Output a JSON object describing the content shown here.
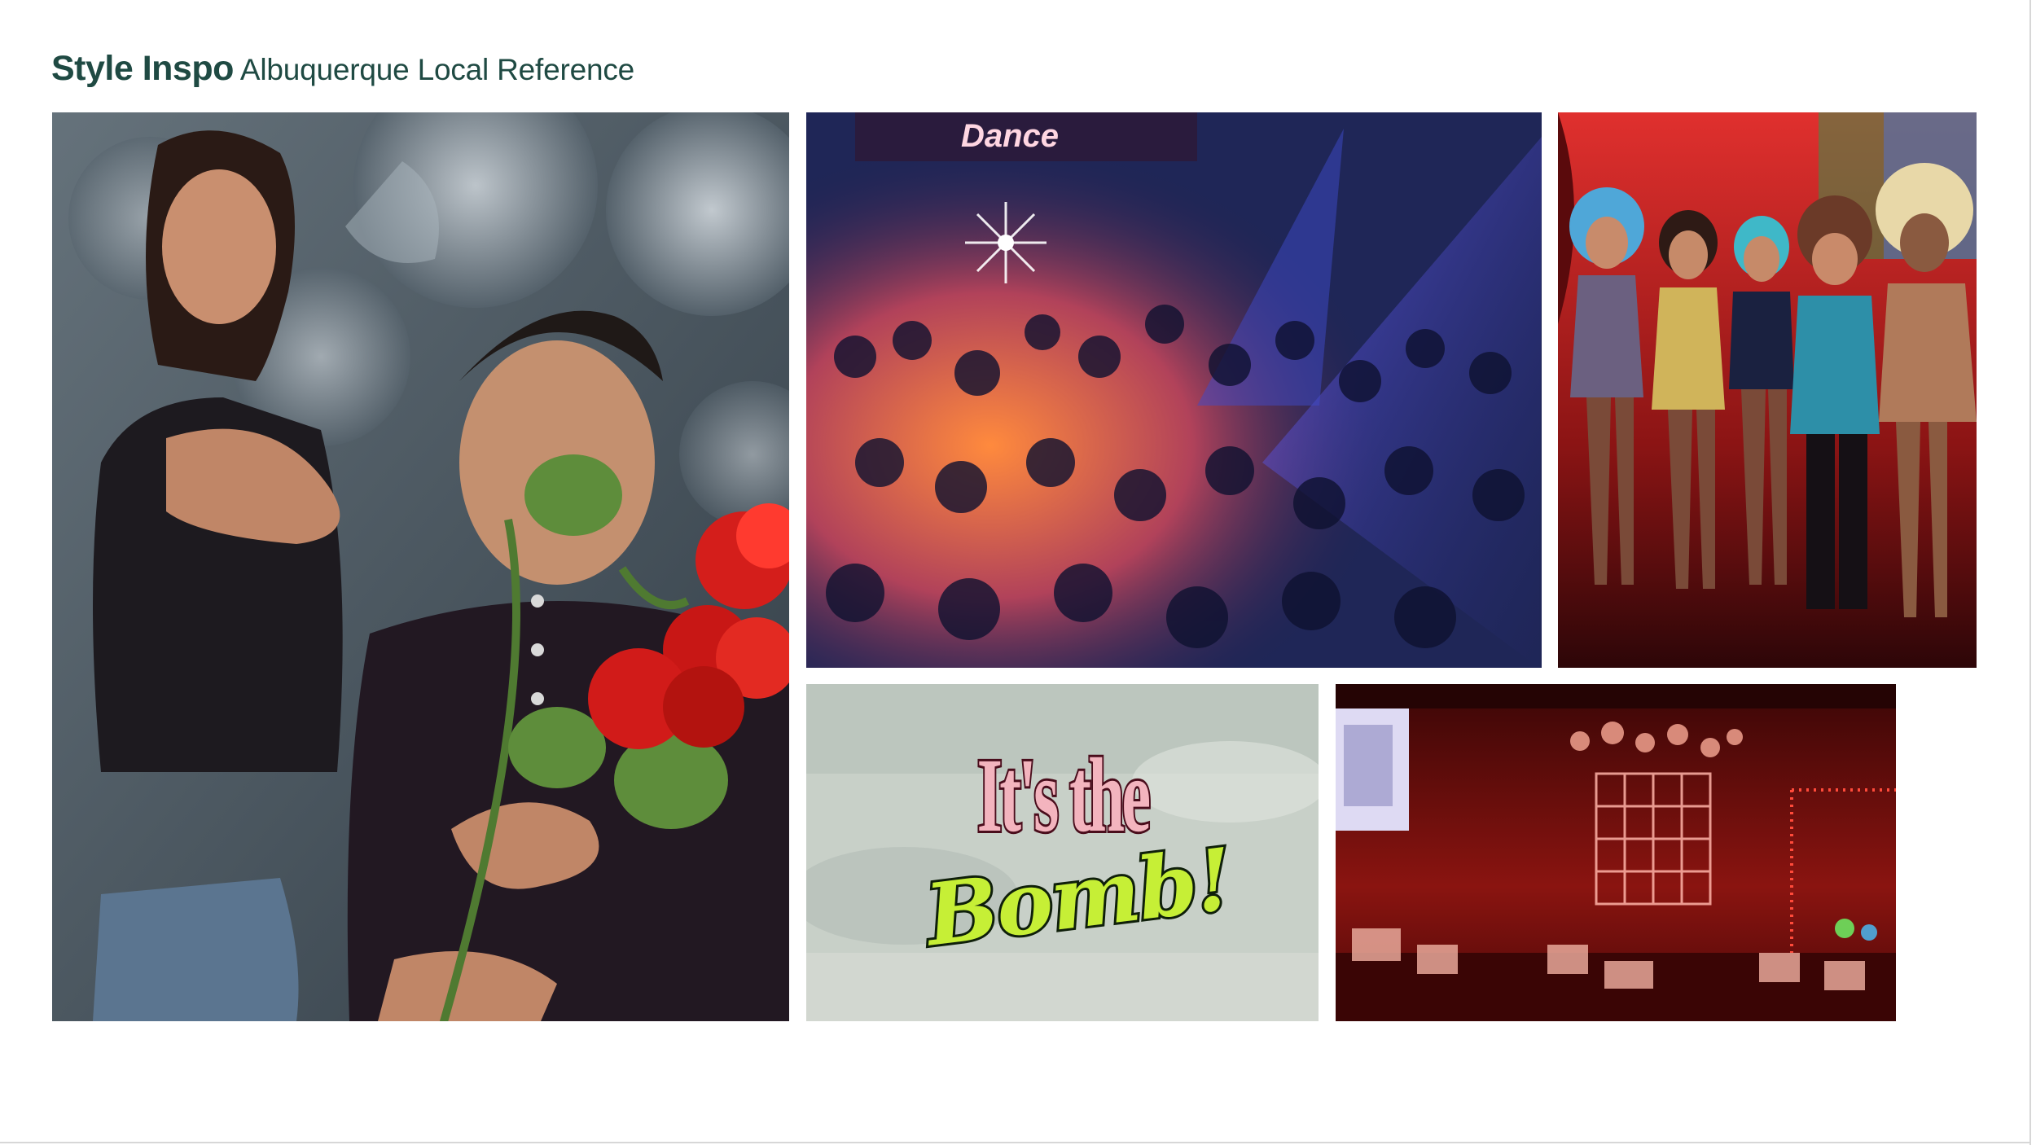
{
  "slide": {
    "title_strong": "Style Inspo",
    "title_sub": "Albuquerque Local Reference"
  },
  "photos": {
    "couple": {
      "description_icon": "couple-with-roses-photo"
    },
    "dance_floor": {
      "sign_text": "Dance"
    },
    "performers": {
      "description_icon": "drag-performers-photo"
    },
    "bomb_card": {
      "line1": "It's the",
      "line2": "Bomb!"
    },
    "club_interior": {
      "description_icon": "red-club-interior-photo"
    }
  },
  "colors": {
    "title": "#1f4a43",
    "bomb_pink": "#f3b4be",
    "bomb_green": "#c6ef36"
  }
}
